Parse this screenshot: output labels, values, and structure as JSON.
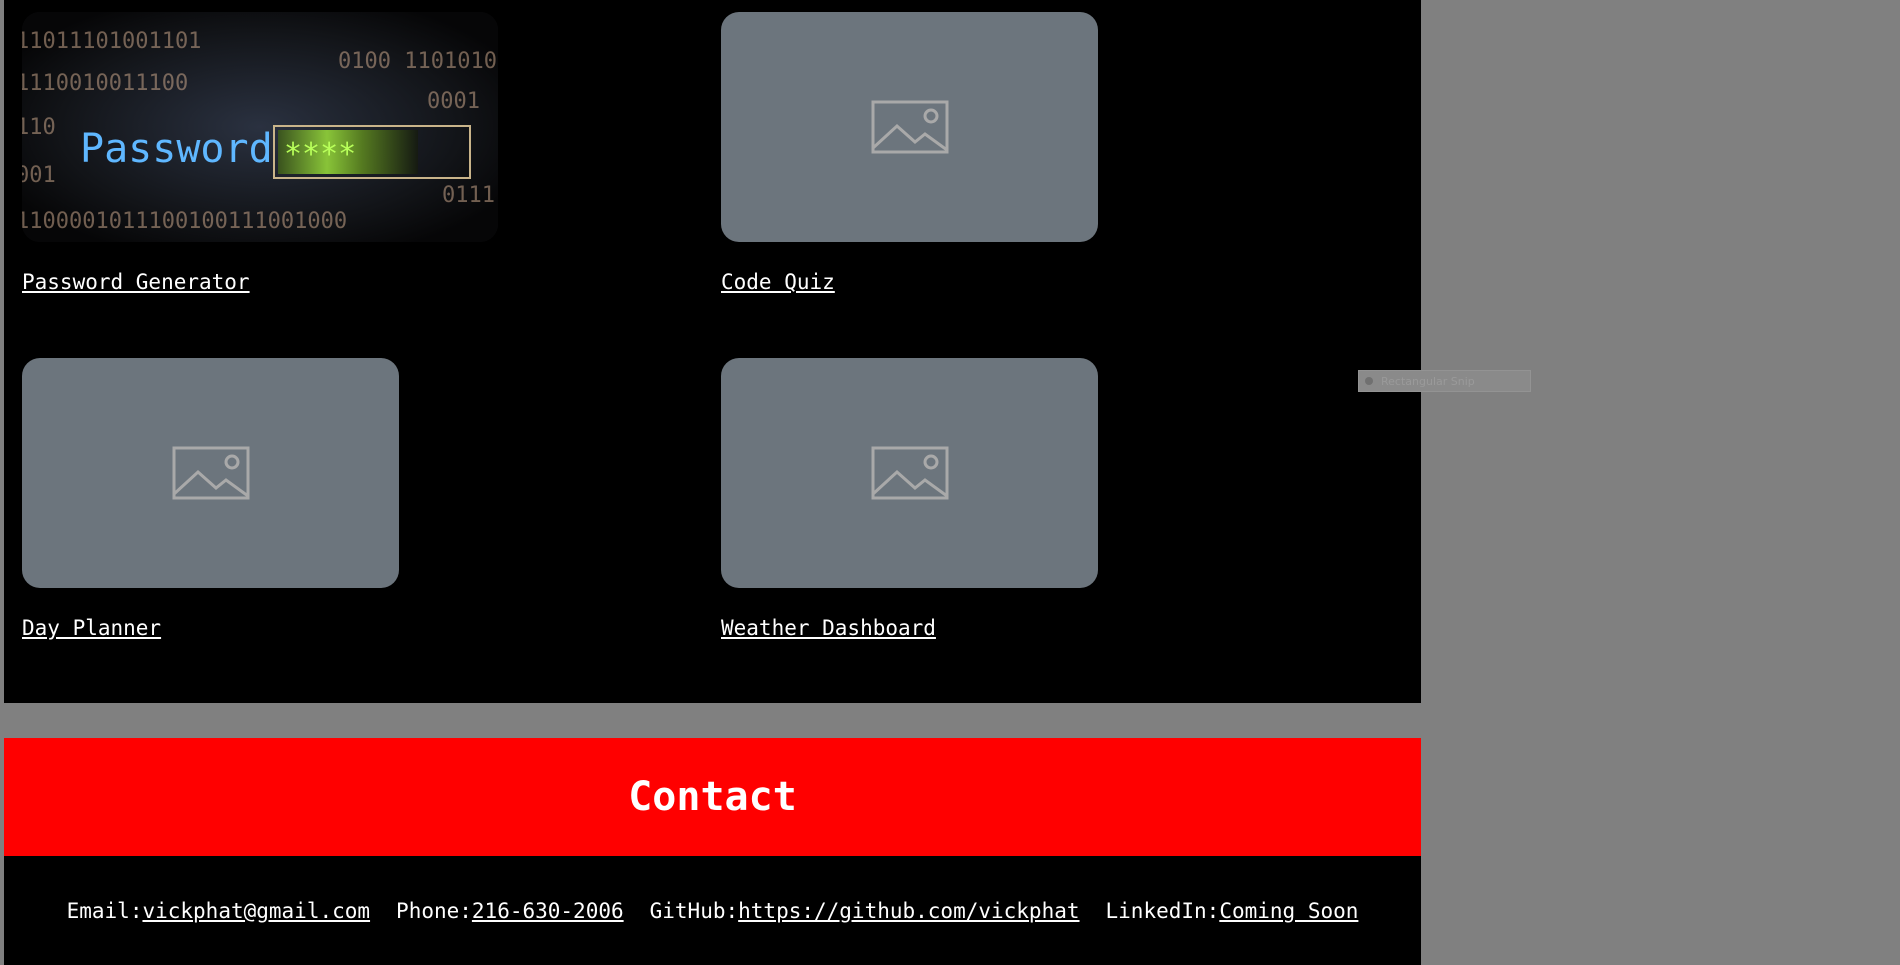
{
  "projects": [
    {
      "title": "Password Generator",
      "image": {
        "type": "photo",
        "caption_words": "Password",
        "mask": "****"
      }
    },
    {
      "title": "Code Quiz",
      "image": {
        "type": "placeholder",
        "icon": "image-placeholder-icon"
      }
    },
    {
      "title": "Day Planner",
      "image": {
        "type": "placeholder",
        "icon": "image-placeholder-icon"
      }
    },
    {
      "title": "Weather Dashboard",
      "image": {
        "type": "placeholder",
        "icon": "image-placeholder-icon"
      }
    }
  ],
  "contact": {
    "heading": "Contact",
    "email_label": "Email:",
    "email": "vickphat@gmail.com",
    "phone_label": "Phone:",
    "phone": "216-630-2006",
    "github_label": "GitHub:",
    "github": "https://github.com/vickphat",
    "linkedin_label": "LinkedIn:",
    "linkedin": "Coming Soon"
  },
  "overlay": {
    "snip_label": "Rectangular Snip"
  },
  "colors": {
    "page_bg": "#808080",
    "section_bg": "#000000",
    "contact_band": "#ff0000",
    "placeholder": "#6c757d"
  }
}
